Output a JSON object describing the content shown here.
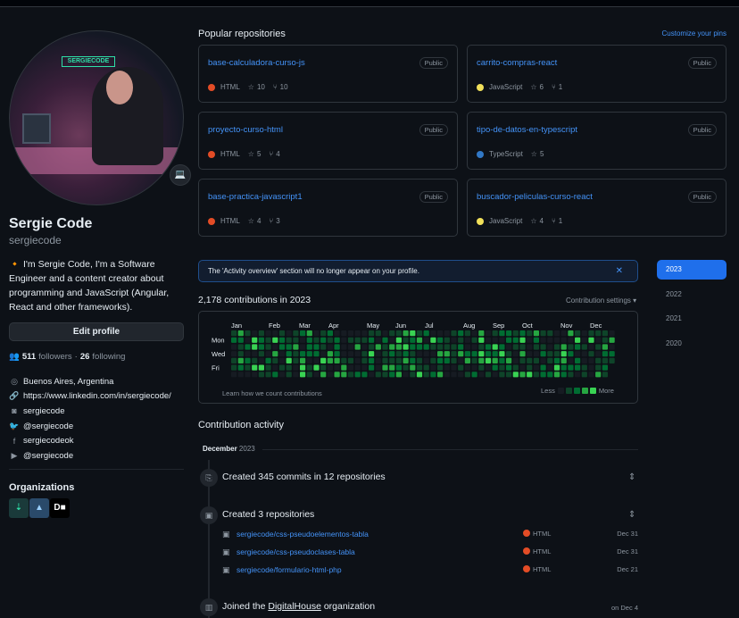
{
  "profile": {
    "full_name": "Sergie Code",
    "login": "sergiecode",
    "status_emoji": "💻",
    "avatar_neon_text": "SERGIECODE",
    "bio": "🔸 I'm Sergie Code, I'm a Software Engineer and a content creator about programming and JavaScript (Angular, React and other frameworks).",
    "edit_label": "Edit profile",
    "followers": "511",
    "followers_label": "followers",
    "following": "26",
    "following_label": "following",
    "separator": "·",
    "location": "Buenos Aires, Argentina",
    "website": "https://www.linkedin.com/in/sergiecode/",
    "instagram": "sergiecode",
    "twitter": "@sergiecode",
    "facebook": "sergiecodeok",
    "youtube": "@sergiecode",
    "orgs_title": "Organizations"
  },
  "orgs": [
    {
      "glyph": "⇣",
      "bg": "#1a3a3a",
      "fg": "#2ee0a8"
    },
    {
      "glyph": "▲",
      "bg": "#2a4a6a",
      "fg": "#9ad0ff"
    },
    {
      "glyph": "D■",
      "bg": "#000000",
      "fg": "#ffffff"
    }
  ],
  "popular": {
    "title": "Popular repositories",
    "customize": "Customize your pins",
    "repos": [
      {
        "name": "base-calculadora-curso-js",
        "visibility": "Public",
        "language": "HTML",
        "lang_color": "#e34c26",
        "stars": "10",
        "forks": "10"
      },
      {
        "name": "carrito-compras-react",
        "visibility": "Public",
        "language": "JavaScript",
        "lang_color": "#f1e05a",
        "stars": "6",
        "forks": "1"
      },
      {
        "name": "proyecto-curso-html",
        "visibility": "Public",
        "language": "HTML",
        "lang_color": "#e34c26",
        "stars": "5",
        "forks": "4"
      },
      {
        "name": "tipo-de-datos-en-typescript",
        "visibility": "Public",
        "language": "TypeScript",
        "lang_color": "#3178c6",
        "stars": "5",
        "forks": ""
      },
      {
        "name": "base-practica-javascript1",
        "visibility": "Public",
        "language": "HTML",
        "lang_color": "#e34c26",
        "stars": "4",
        "forks": "3"
      },
      {
        "name": "buscador-peliculas-curso-react",
        "visibility": "Public",
        "language": "JavaScript",
        "lang_color": "#f1e05a",
        "stars": "4",
        "forks": "1"
      }
    ]
  },
  "notice": {
    "text": "The 'Activity overview' section will no longer appear on your profile.",
    "close": "✕"
  },
  "contributions": {
    "title": "2,178 contributions in 2023",
    "settings": "Contribution settings ▾",
    "months": [
      "Jan",
      "Feb",
      "Mar",
      "Apr",
      "May",
      "Jun",
      "Jul",
      "Aug",
      "Sep",
      "Oct",
      "Nov",
      "Dec"
    ],
    "days": [
      "Mon",
      "Wed",
      "Fri"
    ],
    "learn": "Learn how we count contributions",
    "less": "Less",
    "more": "More",
    "colors": [
      "#161b22",
      "#0e4429",
      "#006d32",
      "#26a641",
      "#39d353"
    ]
  },
  "years": [
    "2023",
    "2022",
    "2021",
    "2020"
  ],
  "activity": {
    "title": "Contribution activity",
    "month": "December",
    "year": "2023",
    "commits": "Created 345 commits in 12 repositories",
    "created": "Created 3 repositories",
    "created_repos": [
      {
        "name": "sergiecode/css-pseudoelementos-tabla",
        "language": "HTML",
        "date": "Dec 31"
      },
      {
        "name": "sergiecode/css-pseudoclases-tabla",
        "language": "HTML",
        "date": "Dec 31"
      },
      {
        "name": "sergiecode/formulario-html-php",
        "language": "HTML",
        "date": "Dec 21"
      }
    ],
    "joined_pre": "Joined the ",
    "joined_org": "DigitalHouse",
    "joined_post": " organization",
    "joined_date": "on Dec 4"
  }
}
